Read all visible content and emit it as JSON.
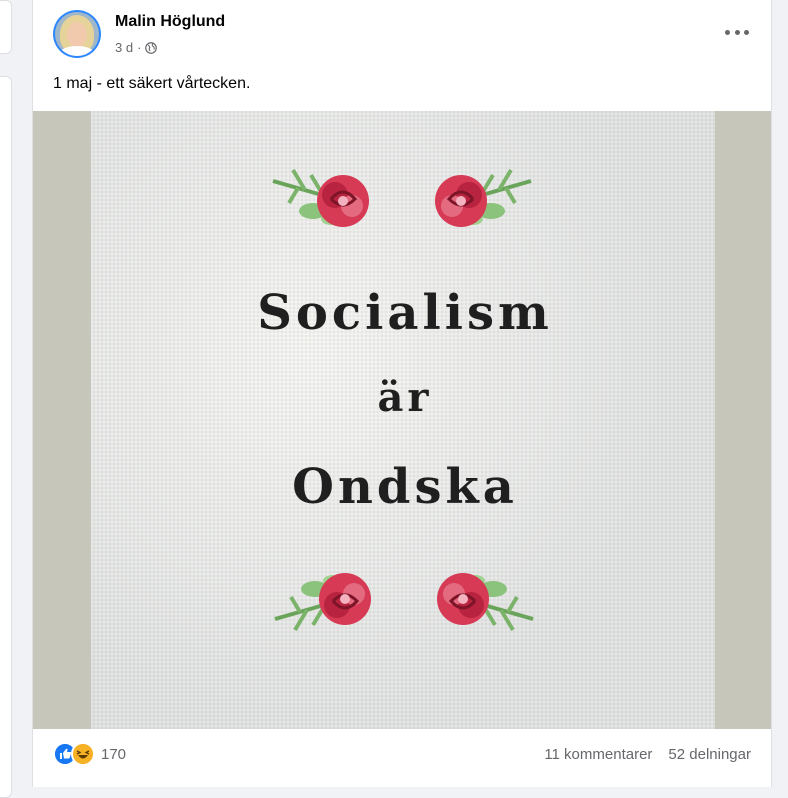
{
  "post": {
    "author": "Malin Höglund",
    "time": "3 d",
    "separator": "·",
    "text": "1 maj - ett säkert vårtecken.",
    "image": {
      "embroidery_lines": [
        "Socialism",
        "är",
        "Ondska"
      ]
    },
    "reactions_count": "170",
    "comments": "11 kommentarer",
    "shares": "52 delningar"
  },
  "colors": {
    "like": "#1877f2",
    "haha": "#f7b125",
    "meta": "#65676b",
    "rose": "#d63a55",
    "leaf": "#7cb36a",
    "thread": "#1f1f1f"
  },
  "icons": [
    "globe-icon",
    "more-icon",
    "like-icon",
    "haha-icon"
  ]
}
